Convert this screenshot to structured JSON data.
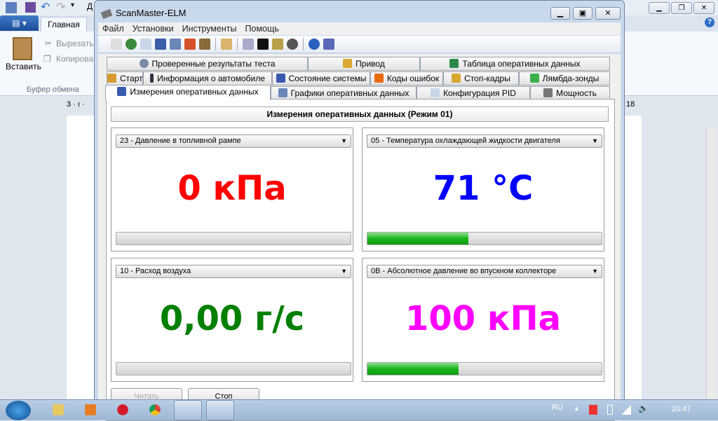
{
  "word": {
    "home_tab": "Главная",
    "paste": "Вставить",
    "cut": "Вырезать",
    "copy": "Копирова",
    "clipboard_group": "Буфер обмена",
    "ruler_left": "3 · ı ·",
    "ruler_right": "18",
    "title_partial": "Д"
  },
  "scanmaster": {
    "title": "ScanMaster-ELM",
    "menu": [
      "Файл",
      "Установки",
      "Инструменты",
      "Помощь"
    ],
    "tabs_row1": [
      "Проверенные результаты теста",
      "Привод",
      "Таблица оперативных данных"
    ],
    "tabs_row2": [
      "Старт",
      "Информация о автомобиле",
      "Состояние системы",
      "Коды ошибок",
      "Стоп-кадры",
      "Лямбда-зонды"
    ],
    "tabs_row3": [
      "Измерения оперативных данных",
      "Графики оперативных данных",
      "Конфигурация PID",
      "Мощность"
    ],
    "header": "Измерения оперативных данных (Режим 01)",
    "panels": [
      {
        "pid": "23 - Давление в топливной рампе",
        "value": "0 кПа",
        "color": "#ff0000",
        "progress": 0
      },
      {
        "pid": "05 - Температура охлаждающей жидкости двигателя",
        "value": "71 °C",
        "color": "#0000ff",
        "progress": 43
      },
      {
        "pid": "10 - Расход воздуха",
        "value": "0,00 г/с",
        "color": "#008000",
        "progress": 0
      },
      {
        "pid": "0B - Абсолютное давление во впускном коллекторе",
        "value": "100 кПа",
        "color": "#ff00ff",
        "progress": 39
      }
    ],
    "read_button": "Читать",
    "stop_button": "Стоп"
  },
  "taskbar": {
    "lang": "RU",
    "clock": "20:47"
  }
}
